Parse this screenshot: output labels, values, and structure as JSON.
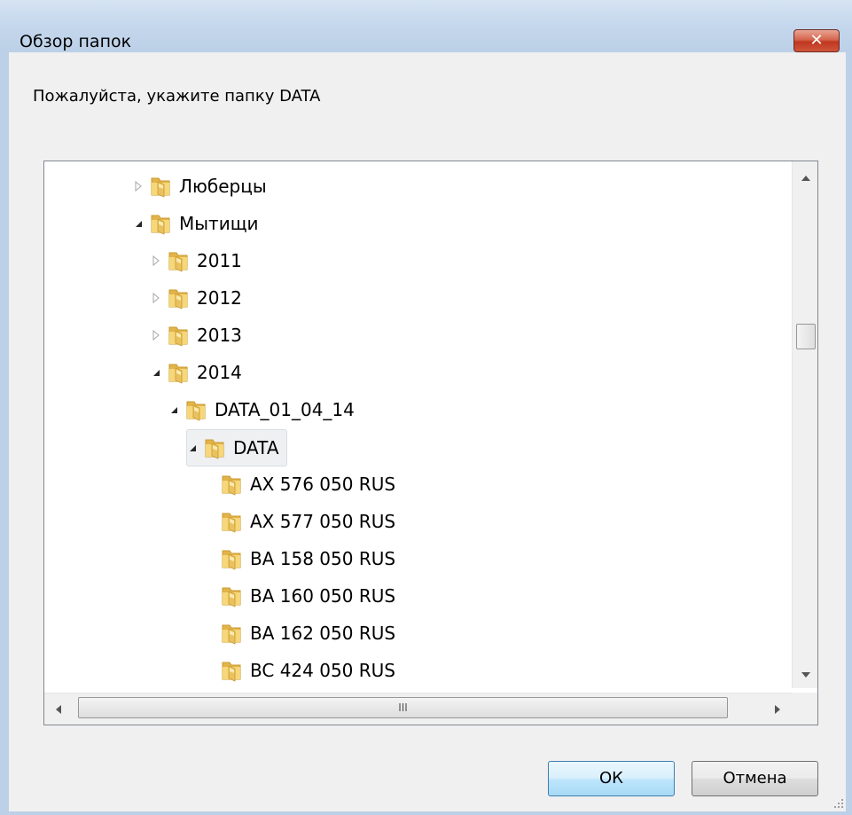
{
  "window": {
    "title": "Обзор папок",
    "close_label": "✕"
  },
  "prompt": "Пожалуйста, укажите папку DATA",
  "tree": {
    "items": [
      {
        "label": "Люберцы",
        "expanded": false,
        "has_children": true,
        "level": 0
      },
      {
        "label": "Мытищи",
        "expanded": true,
        "has_children": true,
        "level": 0
      },
      {
        "label": "2011",
        "expanded": false,
        "has_children": true,
        "level": 1
      },
      {
        "label": "2012",
        "expanded": false,
        "has_children": true,
        "level": 1
      },
      {
        "label": "2013",
        "expanded": false,
        "has_children": true,
        "level": 1
      },
      {
        "label": "2014",
        "expanded": true,
        "has_children": true,
        "level": 1
      },
      {
        "label": "DATA_01_04_14",
        "expanded": true,
        "has_children": true,
        "level": 2
      },
      {
        "label": "DATA",
        "expanded": true,
        "has_children": true,
        "level": 3,
        "selected": true
      },
      {
        "label": "AX 576 050 RUS",
        "has_children": false,
        "level": 4
      },
      {
        "label": "AX 577 050 RUS",
        "has_children": false,
        "level": 4
      },
      {
        "label": "BA 158 050 RUS",
        "has_children": false,
        "level": 4
      },
      {
        "label": "BA 160 050 RUS",
        "has_children": false,
        "level": 4
      },
      {
        "label": "BA 162 050 RUS",
        "has_children": false,
        "level": 4
      },
      {
        "label": "BC 424 050 RUS",
        "has_children": false,
        "level": 4
      }
    ]
  },
  "scrollbar": {
    "horizontal_grip": "III"
  },
  "buttons": {
    "ok": "ОК",
    "cancel": "Отмена"
  },
  "colors": {
    "titlebar": "#c3d6ec",
    "client": "#f0f0f0",
    "close_red": "#c0371f",
    "folder_yellow": "#f2cf6b",
    "ok_button": "#bee6fd"
  }
}
